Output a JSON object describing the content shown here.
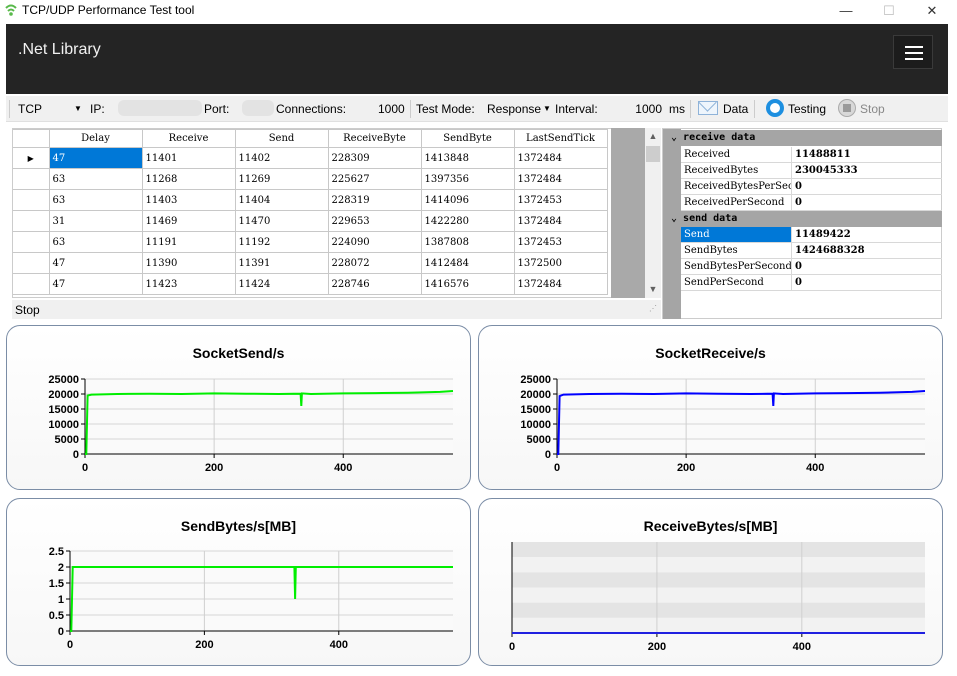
{
  "window": {
    "title": "TCP/UDP Performance Test tool",
    "min": "—",
    "max": "☐",
    "close": "✕"
  },
  "header": {
    "brand": ".Net Library"
  },
  "toolbar": {
    "protocol": "TCP",
    "ip_label": "IP:",
    "port_label": "Port:",
    "connections_label": "Connections:",
    "connections_value": "1000",
    "test_mode_label": "Test Mode:",
    "test_mode_value": "Response",
    "interval_label": "Interval:",
    "interval_value": "1000",
    "interval_unit": "ms",
    "data_button": "Data",
    "testing_button": "Testing",
    "stop_button": "Stop"
  },
  "grid": {
    "columns": [
      "Delay",
      "Receive",
      "Send",
      "ReceiveByte",
      "SendByte",
      "LastSendTick"
    ],
    "rows": [
      [
        "47",
        "11401",
        "11402",
        "228309",
        "1413848",
        "1372484"
      ],
      [
        "63",
        "11268",
        "11269",
        "225627",
        "1397356",
        "1372484"
      ],
      [
        "63",
        "11403",
        "11404",
        "228319",
        "1414096",
        "1372453"
      ],
      [
        "31",
        "11469",
        "11470",
        "229653",
        "1422280",
        "1372484"
      ],
      [
        "63",
        "11191",
        "11192",
        "224090",
        "1387808",
        "1372453"
      ],
      [
        "47",
        "11390",
        "11391",
        "228072",
        "1412484",
        "1372500"
      ],
      [
        "47",
        "11423",
        "11424",
        "228746",
        "1416576",
        "1372484"
      ]
    ]
  },
  "status": {
    "text": "Stop"
  },
  "properties": {
    "receive_category": "receive data",
    "receive": [
      {
        "key": "Received",
        "value": "11488811"
      },
      {
        "key": "ReceivedBytes",
        "value": "230045333"
      },
      {
        "key": "ReceivedBytesPerSecond",
        "value": "0"
      },
      {
        "key": "ReceivedPerSecond",
        "value": "0"
      }
    ],
    "send_category": "send data",
    "send": [
      {
        "key": "Send",
        "value": "11489422"
      },
      {
        "key": "SendBytes",
        "value": "1424688328"
      },
      {
        "key": "SendBytesPerSecond",
        "value": "0"
      },
      {
        "key": "SendPerSecond",
        "value": "0"
      }
    ]
  },
  "chart_data": [
    {
      "type": "line",
      "title": "SocketSend/s",
      "color": "#00ee00",
      "xlim": [
        0,
        570
      ],
      "ylim": [
        0,
        25000
      ],
      "xticks": [
        0,
        200,
        400
      ],
      "yticks": [
        "0",
        "5000",
        "10000",
        "15000",
        "20000",
        "25000"
      ],
      "series": [
        {
          "x": [
            0,
            2,
            4,
            10,
            50,
            100,
            150,
            200,
            250,
            300,
            334,
            335,
            336,
            350,
            400,
            450,
            500,
            550,
            570
          ],
          "values": [
            0,
            0,
            19500,
            19800,
            20000,
            20100,
            20000,
            20200,
            20100,
            20000,
            20100,
            16000,
            20200,
            20000,
            20200,
            20300,
            20400,
            20700,
            21000
          ]
        }
      ]
    },
    {
      "type": "line",
      "title": "SocketReceive/s",
      "color": "#0000ff",
      "xlim": [
        0,
        570
      ],
      "ylim": [
        0,
        25000
      ],
      "xticks": [
        0,
        200,
        400
      ],
      "yticks": [
        "0",
        "5000",
        "10000",
        "15000",
        "20000",
        "25000"
      ],
      "series": [
        {
          "x": [
            0,
            2,
            4,
            10,
            50,
            100,
            150,
            200,
            250,
            300,
            334,
            335,
            336,
            350,
            400,
            450,
            500,
            550,
            570
          ],
          "values": [
            0,
            0,
            19300,
            19800,
            20000,
            20100,
            20000,
            20200,
            20100,
            20000,
            20100,
            16000,
            20200,
            20000,
            20200,
            20300,
            20400,
            20700,
            21000
          ]
        }
      ]
    },
    {
      "type": "line",
      "title": "SendBytes/s[MB]",
      "color": "#00ee00",
      "xlim": [
        0,
        570
      ],
      "ylim": [
        0,
        2.5
      ],
      "xticks": [
        0,
        200,
        400
      ],
      "yticks": [
        "0",
        "0.5",
        "1",
        "1.5",
        "2",
        "2.5"
      ],
      "series": [
        {
          "x": [
            0,
            2,
            4,
            334,
            335,
            336,
            570
          ],
          "values": [
            0,
            0,
            2,
            2,
            1,
            2,
            2
          ]
        }
      ]
    },
    {
      "type": "line",
      "title": "ReceiveBytes/s[MB]",
      "color": "#2020e0",
      "xlim": [
        0,
        570
      ],
      "ylim": [
        0,
        1
      ],
      "xticks": [
        0,
        200,
        400
      ],
      "yticks": [],
      "series": [
        {
          "x": [
            0,
            570
          ],
          "values": [
            0,
            0
          ]
        }
      ]
    }
  ]
}
